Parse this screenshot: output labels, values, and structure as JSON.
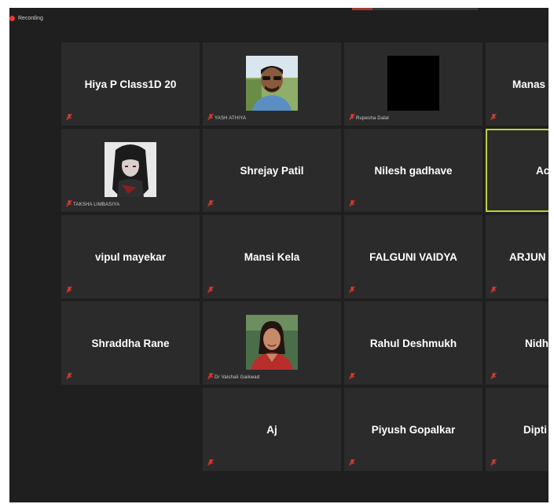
{
  "recording": {
    "label": "Recording"
  },
  "colors": {
    "background": "#1f1f1f",
    "tile": "#2b2b2b",
    "active_border": "#bfcf3a",
    "mute_icon": "#e23b2e"
  },
  "tiles": [
    {
      "name": "Hiya P Class1D 20",
      "muted": true
    },
    {
      "name": "YASH ATHIYA",
      "muted": true,
      "avatar": "photo-man-sunglasses"
    },
    {
      "name": "Rupesha Dalal",
      "muted": true,
      "avatar": "black-square"
    },
    {
      "name": "Manas",
      "muted": true
    },
    {
      "name": "TAKSHA LIMBASIYA",
      "muted": true,
      "avatar": "anime-character"
    },
    {
      "name": "Shrejay Patil",
      "muted": true
    },
    {
      "name": "Nilesh gadhave",
      "muted": true
    },
    {
      "name": "Ac",
      "muted": false,
      "active_speaker": true
    },
    {
      "name": "vipul mayekar",
      "muted": true
    },
    {
      "name": "Mansi Kela",
      "muted": true
    },
    {
      "name": "FALGUNI VAIDYA",
      "muted": true
    },
    {
      "name": "ARJUN",
      "muted": true
    },
    {
      "name": "Shraddha Rane",
      "muted": true
    },
    {
      "name": "Dr Vaishali Gaikwad",
      "muted": true,
      "avatar": "photo-woman"
    },
    {
      "name": "Rahul Deshmukh",
      "muted": true
    },
    {
      "name": "Nidh",
      "muted": true
    },
    {
      "name": "Aj",
      "muted": true
    },
    {
      "name": "Piyush Gopalkar",
      "muted": true
    },
    {
      "name": "Dipti",
      "muted": true
    }
  ]
}
